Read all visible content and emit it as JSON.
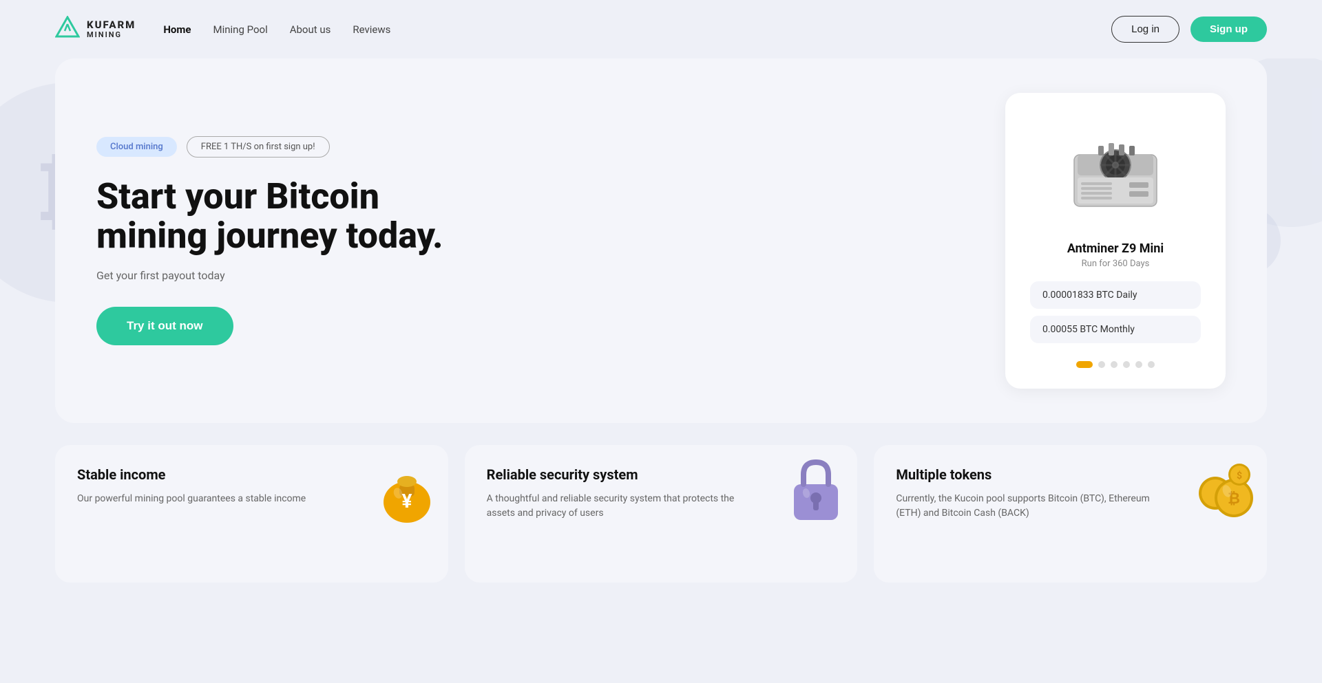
{
  "brand": {
    "logo_top": "KUFARM",
    "logo_bottom": "MINING"
  },
  "navbar": {
    "links": [
      {
        "label": "Home",
        "active": true
      },
      {
        "label": "Mining Pool",
        "active": false
      },
      {
        "label": "About us",
        "active": false
      },
      {
        "label": "Reviews",
        "active": false
      }
    ],
    "login_label": "Log in",
    "signup_label": "Sign up"
  },
  "hero": {
    "tag_cloud": "Cloud mining",
    "tag_free": "FREE 1 TH/S on first sign up!",
    "title": "Start your Bitcoin mining journey today.",
    "subtitle": "Get your first payout today",
    "cta": "Try it out now"
  },
  "product_card": {
    "name": "Antminer Z9 Mini",
    "days": "Run for 360 Days",
    "daily": "0.00001833 BTC Daily",
    "monthly": "0.00055 BTC Monthly"
  },
  "carousel": {
    "dots": [
      {
        "active": true
      },
      {
        "active": false
      },
      {
        "active": false
      },
      {
        "active": false
      },
      {
        "active": false
      },
      {
        "active": false
      }
    ]
  },
  "features": [
    {
      "title": "Stable income",
      "desc": "Our powerful mining pool guarantees a stable income",
      "icon": "money-bag"
    },
    {
      "title": "Reliable security system",
      "desc": "A thoughtful and reliable security system that protects the assets and privacy of users",
      "icon": "lock"
    },
    {
      "title": "Multiple tokens",
      "desc": "Currently, the Kucoin pool supports Bitcoin (BTC), Ethereum (ETH) and Bitcoin Cash (BACK)",
      "icon": "coins"
    }
  ]
}
